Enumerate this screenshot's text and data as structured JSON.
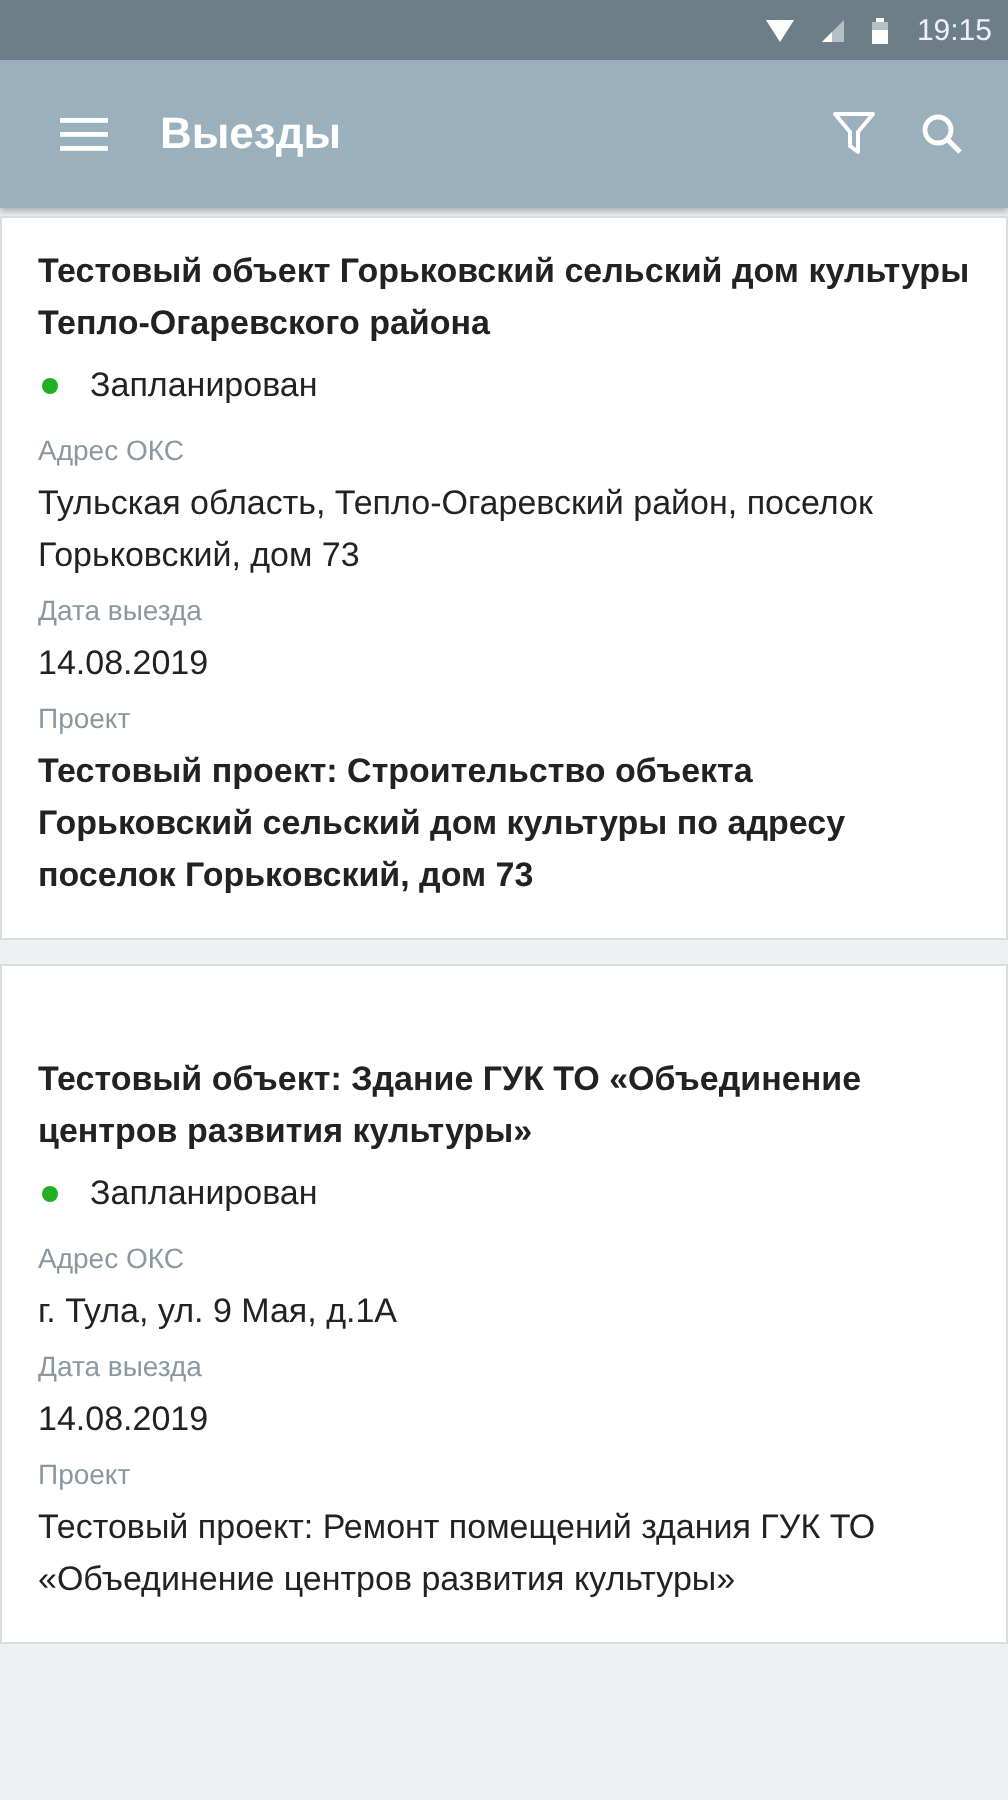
{
  "status_bar": {
    "time": "19:15"
  },
  "app_bar": {
    "title": "Выезды"
  },
  "cards": [
    {
      "title": "Тестовый объект Горьковский сельский дом культуры Тепло-Огаревского района",
      "status": {
        "label": "Запланирован",
        "color": "#22b022"
      },
      "fields": [
        {
          "label": "Адрес ОКС",
          "value": "Тульская область, Тепло-Огаревский район, поселок Горьковский, дом 73",
          "bold": false
        },
        {
          "label": "Дата выезда",
          "value": "14.08.2019",
          "bold": false
        },
        {
          "label": "Проект",
          "value": "Тестовый проект: Строительство объекта Горьковский сельский дом культуры по адресу поселок Горьковский, дом 73",
          "bold": true
        }
      ]
    },
    {
      "title": "Тестовый объект: Здание ГУК ТО «Объединение центров развития культуры»",
      "status": {
        "label": "Запланирован",
        "color": "#22b022"
      },
      "fields": [
        {
          "label": "Адрес ОКС",
          "value": "г. Тула, ул. 9 Мая, д.1А",
          "bold": false
        },
        {
          "label": "Дата выезда",
          "value": "14.08.2019",
          "bold": false
        },
        {
          "label": "Проект",
          "value": "Тестовый проект: Ремонт помещений здания ГУК ТО «Объединение центров развития культуры»",
          "bold": false
        }
      ]
    }
  ]
}
